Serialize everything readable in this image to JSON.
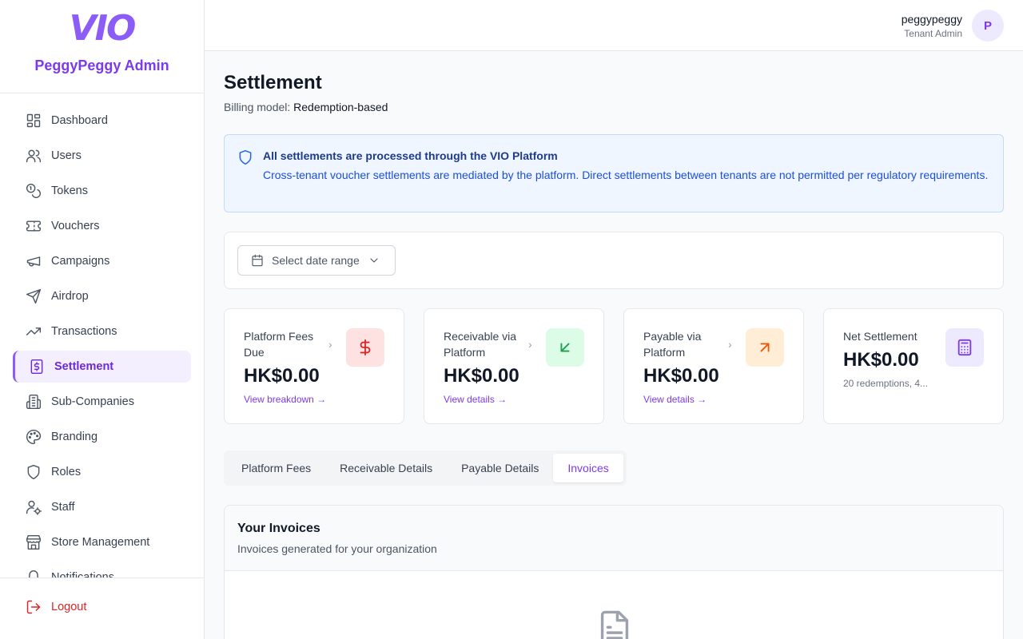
{
  "brand": {
    "logo": "VIO",
    "name": "PeggyPeggy Admin"
  },
  "sidebar": {
    "items": [
      {
        "label": "Dashboard",
        "icon": "dashboard-icon"
      },
      {
        "label": "Users",
        "icon": "users-icon"
      },
      {
        "label": "Tokens",
        "icon": "coins-icon"
      },
      {
        "label": "Vouchers",
        "icon": "ticket-icon"
      },
      {
        "label": "Campaigns",
        "icon": "megaphone-icon"
      },
      {
        "label": "Airdrop",
        "icon": "send-icon"
      },
      {
        "label": "Transactions",
        "icon": "trending-up-icon"
      },
      {
        "label": "Settlement",
        "icon": "receipt-icon",
        "active": true
      },
      {
        "label": "Sub-Companies",
        "icon": "building-icon"
      },
      {
        "label": "Branding",
        "icon": "palette-icon"
      },
      {
        "label": "Roles",
        "icon": "shield-icon"
      },
      {
        "label": "Staff",
        "icon": "user-cog-icon"
      },
      {
        "label": "Store Management",
        "icon": "store-icon"
      },
      {
        "label": "Notifications",
        "icon": "bell-icon"
      }
    ],
    "logout": "Logout"
  },
  "header": {
    "user_name": "peggypeggy",
    "user_role": "Tenant Admin",
    "avatar_initial": "P"
  },
  "page": {
    "title": "Settlement",
    "billing_label": "Billing model:",
    "billing_value": "Redemption-based"
  },
  "notice": {
    "title": "All settlements are processed through the VIO Platform",
    "text": "Cross-tenant voucher settlements are mediated by the platform. Direct settlements between tenants are not permitted per regulatory requirements."
  },
  "filter": {
    "date_placeholder": "Select date range"
  },
  "stats": [
    {
      "label": "Platform Fees Due",
      "value": "HK$0.00",
      "link": "View breakdown →",
      "icon": "dollar-icon",
      "color": "#dc2626",
      "bg": "#fee2e2"
    },
    {
      "label": "Receivable via Platform",
      "value": "HK$0.00",
      "link": "View details →",
      "icon": "arrow-down-left-icon",
      "color": "#16a34a",
      "bg": "#dcfce7"
    },
    {
      "label": "Payable via Platform",
      "value": "HK$0.00",
      "link": "View details →",
      "icon": "arrow-up-right-icon",
      "color": "#ea580c",
      "bg": "#ffedd5"
    },
    {
      "label": "Net Settlement",
      "value": "HK$0.00",
      "sub": "20 redemptions, 4...",
      "icon": "calculator-icon",
      "color": "#7c3aed",
      "bg": "#ede9fe"
    }
  ],
  "tabs": [
    {
      "label": "Platform Fees"
    },
    {
      "label": "Receivable Details"
    },
    {
      "label": "Payable Details"
    },
    {
      "label": "Invoices",
      "active": true
    }
  ],
  "invoices": {
    "title": "Your Invoices",
    "subtitle": "Invoices generated for your organization"
  }
}
